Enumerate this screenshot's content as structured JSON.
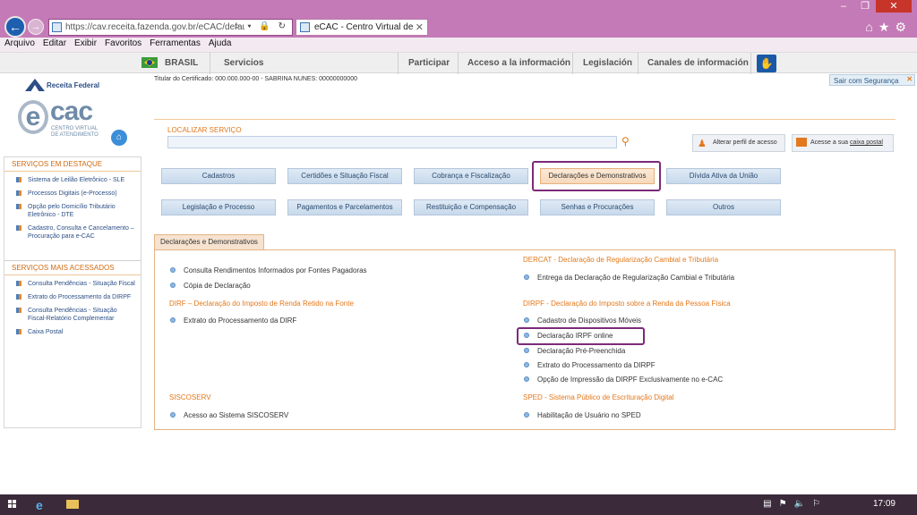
{
  "browser": {
    "url": "https://cav.receita.fazenda.gov.br/eCAC/default.as",
    "address_icons": "⌕ ▾ 🔒 ↻",
    "tab_title": "eCAC - Centro Virtual de At...",
    "tab_close": "✕",
    "window_controls": [
      "–",
      "❐",
      "✕"
    ],
    "tool_icons": [
      "home-icon",
      "star-icon",
      "gear-icon"
    ],
    "menu": [
      "Arquivo",
      "Editar",
      "Exibir",
      "Favoritos",
      "Ferramentas",
      "Ajuda"
    ]
  },
  "govbar": {
    "brasil": "BRASIL",
    "servicios": "Servicios",
    "items": [
      "Participar",
      "Acceso a la información",
      "Legislación",
      "Canales de información"
    ]
  },
  "header": {
    "rf_logo": "Receita Federal",
    "cert_text": "Titular do Certificado: 000.000.000-00 - SABRINA NUNES: 00000000000",
    "sair": "Sair com Segurança",
    "ecac_letters": [
      "e",
      "cac"
    ],
    "ecac_sub": "CENTRO VIRTUAL DE ATENDIMENTO"
  },
  "search": {
    "label": "LOCALIZAR SERVIÇO",
    "value": "",
    "perfil": "Alterar perfil de acesso",
    "caixa_prefix": "Acesse a sua ",
    "caixa_link": "caixa postal"
  },
  "sidebar": {
    "destaque_title": "SERVIÇOS EM DESTAQUE",
    "destaque": [
      "Sistema de Leilão Eletrônico - SLE",
      "Processos Digitais (e-Processo)",
      "Opção pelo Domicílio Tributário Eletrônico - DTE",
      "Cadastro, Consulta e Cancelamento – Procuração para e-CAC"
    ],
    "acessados_title": "SERVIÇOS MAIS ACESSADOS",
    "acessados": [
      "Consulta Pendências - Situação Fiscal",
      "Extrato do Processamento da DIRPF",
      "Consulta Pendências - Situação Fiscal-Relatório Complementar",
      "Caixa Postal"
    ]
  },
  "categories": [
    "Cadastros",
    "Certidões e Situação Fiscal",
    "Cobrança e Fiscalização",
    "Declarações e Demonstrativos",
    "Dívida Ativa da União",
    "Legislação e Processo",
    "Pagamentos e Parcelamentos",
    "Restituição e Compensação",
    "Senhas e Procurações",
    "Outros"
  ],
  "active_category": "Declarações e Demonstrativos",
  "content": {
    "tab": "Declarações e Demonstrativos",
    "left": {
      "general": [
        "Consulta Rendimentos Informados por Fontes Pagadoras",
        "Cópia de Declaração"
      ],
      "dirf_title": "DIRF – Declaração do Imposto de Renda Retido na Fonte",
      "dirf": [
        "Extrato do Processamento da DIRF"
      ],
      "siscoserv_title": "SISCOSERV",
      "siscoserv": [
        "Acesso ao Sistema SISCOSERV"
      ]
    },
    "right": {
      "dercat_title": "DERCAT - Declaração de Regularização Cambial e Tributária",
      "dercat": [
        "Entrega da Declaração de Regularização Cambial e Tributária"
      ],
      "dirpf_title": "DIRPF - Declaração do Imposto sobre a Renda da Pessoa Física",
      "dirpf": [
        "Cadastro de Dispositivos Móveis",
        "Declaração IRPF online",
        "Declaração Pré-Preenchida",
        "Extrato do Processamento da DIRPF",
        "Opção de Impressão da DIRPF Exclusivamente no e-CAC"
      ],
      "sped_title": "SPED - Sistema Público de Escrituração Digital",
      "sped": [
        "Habilitação de Usuário no SPED"
      ]
    }
  },
  "taskbar": {
    "tray_icons": [
      "network-icon",
      "flag-icon",
      "volume-icon",
      "action-center-icon"
    ],
    "time": "17:09"
  },
  "colors": {
    "accent_orange": "#e3781c",
    "highlight_purple": "#7c2a79",
    "chrome": "#c47ab6"
  }
}
